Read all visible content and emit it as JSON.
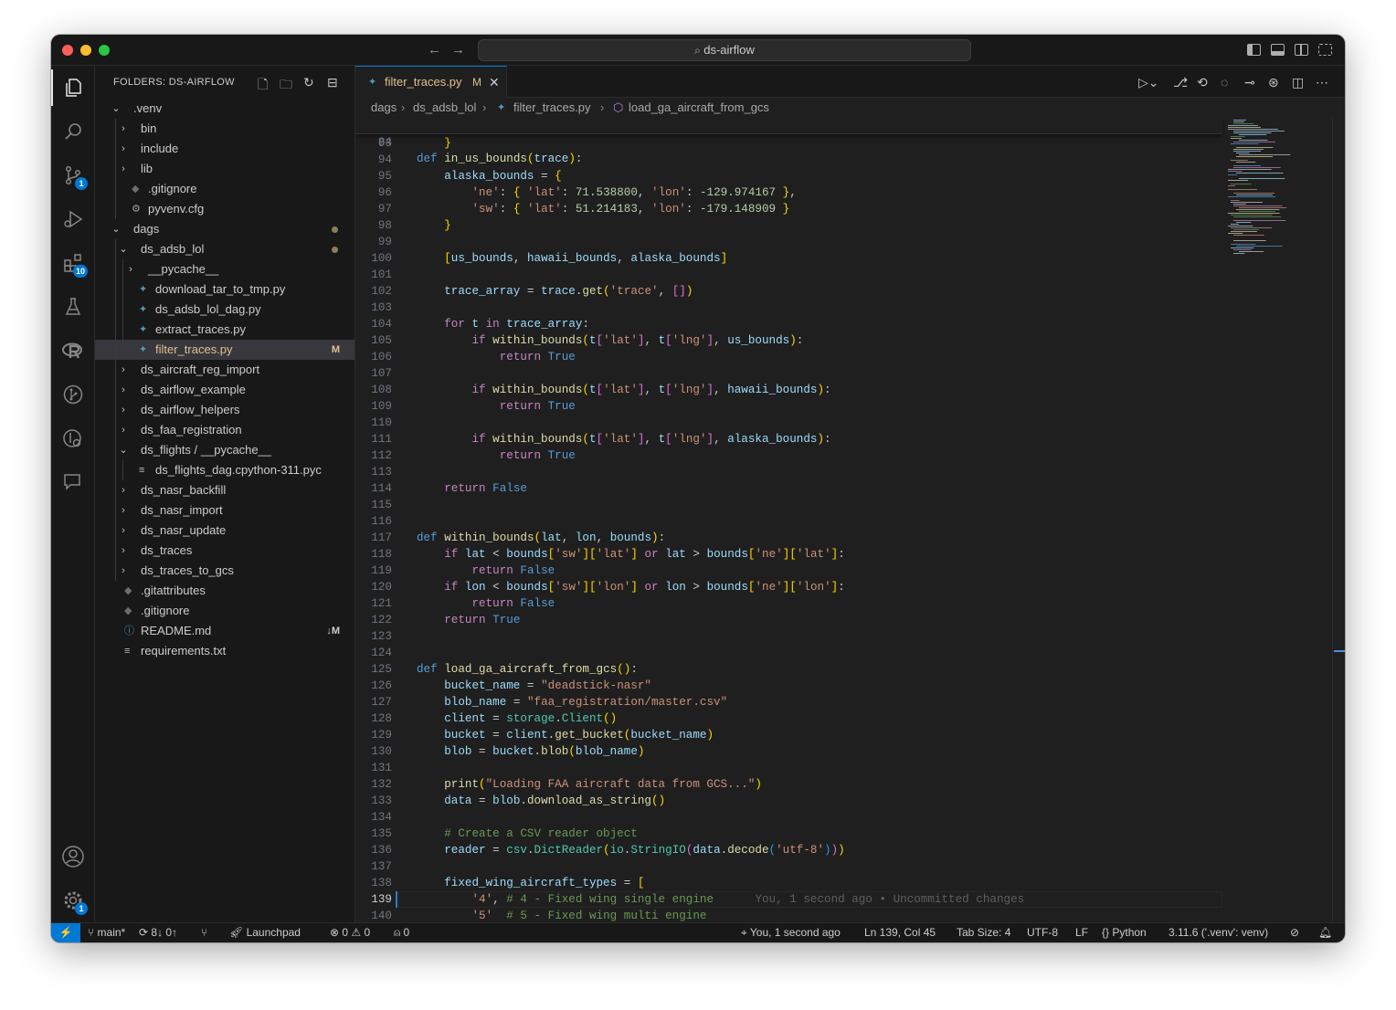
{
  "window": {
    "search_text": "ds-airflow"
  },
  "activity_bar": {
    "scm_badge": "1",
    "extensions_badge": "10",
    "manage_badge": "1"
  },
  "explorer": {
    "title": "FOLDERS: DS-AIRFLOW",
    "tree": [
      {
        "label": ".venv",
        "depth": 0,
        "kind": "folder-open",
        "deco": ""
      },
      {
        "label": "bin",
        "depth": 1,
        "kind": "folder",
        "deco": ""
      },
      {
        "label": "include",
        "depth": 1,
        "kind": "folder",
        "deco": ""
      },
      {
        "label": "lib",
        "depth": 1,
        "kind": "folder",
        "deco": ""
      },
      {
        "label": ".gitignore",
        "depth": 1,
        "kind": "git",
        "deco": ""
      },
      {
        "label": "pyvenv.cfg",
        "depth": 1,
        "kind": "gear",
        "deco": ""
      },
      {
        "label": "dags",
        "depth": 0,
        "kind": "folder-open",
        "deco": "dot"
      },
      {
        "label": "ds_adsb_lol",
        "depth": 1,
        "kind": "folder-open",
        "deco": "dot"
      },
      {
        "label": "__pycache__",
        "depth": 2,
        "kind": "folder",
        "deco": ""
      },
      {
        "label": "download_tar_to_tmp.py",
        "depth": 2,
        "kind": "py",
        "deco": ""
      },
      {
        "label": "ds_adsb_lol_dag.py",
        "depth": 2,
        "kind": "py",
        "deco": ""
      },
      {
        "label": "extract_traces.py",
        "depth": 2,
        "kind": "py",
        "deco": ""
      },
      {
        "label": "filter_traces.py",
        "depth": 2,
        "kind": "py",
        "deco": "M",
        "selected": true
      },
      {
        "label": "ds_aircraft_reg_import",
        "depth": 1,
        "kind": "folder",
        "deco": ""
      },
      {
        "label": "ds_airflow_example",
        "depth": 1,
        "kind": "folder",
        "deco": ""
      },
      {
        "label": "ds_airflow_helpers",
        "depth": 1,
        "kind": "folder",
        "deco": ""
      },
      {
        "label": "ds_faa_registration",
        "depth": 1,
        "kind": "folder",
        "deco": ""
      },
      {
        "label": "ds_flights / __pycache__",
        "depth": 1,
        "kind": "folder-open",
        "deco": ""
      },
      {
        "label": "ds_flights_dag.cpython-311.pyc",
        "depth": 2,
        "kind": "lines",
        "deco": ""
      },
      {
        "label": "ds_nasr_backfill",
        "depth": 1,
        "kind": "folder",
        "deco": ""
      },
      {
        "label": "ds_nasr_import",
        "depth": 1,
        "kind": "folder",
        "deco": ""
      },
      {
        "label": "ds_nasr_update",
        "depth": 1,
        "kind": "folder",
        "deco": ""
      },
      {
        "label": "ds_traces",
        "depth": 1,
        "kind": "folder",
        "deco": ""
      },
      {
        "label": "ds_traces_to_gcs",
        "depth": 1,
        "kind": "folder",
        "deco": ""
      },
      {
        "label": ".gitattributes",
        "depth": 0,
        "kind": "git",
        "deco": ""
      },
      {
        "label": ".gitignore",
        "depth": 0,
        "kind": "git",
        "deco": ""
      },
      {
        "label": "README.md",
        "depth": 0,
        "kind": "info",
        "deco": "↓M"
      },
      {
        "label": "requirements.txt",
        "depth": 0,
        "kind": "lines",
        "deco": ""
      }
    ]
  },
  "tab": {
    "label": "filter_traces.py",
    "status": "M"
  },
  "breadcrumb": [
    "dags",
    "ds_adsb_lol",
    "filter_traces.py",
    "load_ga_aircraft_from_gcs"
  ],
  "sticky": {
    "ln": "84",
    "code": "def in_us_bounds(trace):"
  },
  "editor": {
    "lines": [
      {
        "n": "93",
        "c": "    }"
      },
      {
        "n": "94",
        "c": ""
      },
      {
        "n": "95",
        "c": "    alaska_bounds = {"
      },
      {
        "n": "96",
        "c": "        'ne': { 'lat': 71.538800, 'lon': -129.974167 },"
      },
      {
        "n": "97",
        "c": "        'sw': { 'lat': 51.214183, 'lon': -179.148909 }"
      },
      {
        "n": "98",
        "c": "    }"
      },
      {
        "n": "99",
        "c": ""
      },
      {
        "n": "100",
        "c": "    [us_bounds, hawaii_bounds, alaska_bounds]"
      },
      {
        "n": "101",
        "c": ""
      },
      {
        "n": "102",
        "c": "    trace_array = trace.get('trace', [])"
      },
      {
        "n": "103",
        "c": ""
      },
      {
        "n": "104",
        "c": "    for t in trace_array:"
      },
      {
        "n": "105",
        "c": "        if within_bounds(t['lat'], t['lng'], us_bounds):"
      },
      {
        "n": "106",
        "c": "            return True"
      },
      {
        "n": "107",
        "c": ""
      },
      {
        "n": "108",
        "c": "        if within_bounds(t['lat'], t['lng'], hawaii_bounds):"
      },
      {
        "n": "109",
        "c": "            return True"
      },
      {
        "n": "110",
        "c": ""
      },
      {
        "n": "111",
        "c": "        if within_bounds(t['lat'], t['lng'], alaska_bounds):"
      },
      {
        "n": "112",
        "c": "            return True"
      },
      {
        "n": "113",
        "c": ""
      },
      {
        "n": "114",
        "c": "    return False"
      },
      {
        "n": "115",
        "c": ""
      },
      {
        "n": "116",
        "c": ""
      },
      {
        "n": "117",
        "c": "def within_bounds(lat, lon, bounds):"
      },
      {
        "n": "118",
        "c": "    if lat < bounds['sw']['lat'] or lat > bounds['ne']['lat']:"
      },
      {
        "n": "119",
        "c": "        return False"
      },
      {
        "n": "120",
        "c": "    if lon < bounds['sw']['lon'] or lon > bounds['ne']['lon']:"
      },
      {
        "n": "121",
        "c": "        return False"
      },
      {
        "n": "122",
        "c": "    return True"
      },
      {
        "n": "123",
        "c": ""
      },
      {
        "n": "124",
        "c": ""
      },
      {
        "n": "125",
        "c": "def load_ga_aircraft_from_gcs():"
      },
      {
        "n": "126",
        "c": "    bucket_name = \"deadstick-nasr\""
      },
      {
        "n": "127",
        "c": "    blob_name = \"faa_registration/master.csv\""
      },
      {
        "n": "128",
        "c": "    client = storage.Client()"
      },
      {
        "n": "129",
        "c": "    bucket = client.get_bucket(bucket_name)"
      },
      {
        "n": "130",
        "c": "    blob = bucket.blob(blob_name)"
      },
      {
        "n": "131",
        "c": ""
      },
      {
        "n": "132",
        "c": "    print(\"Loading FAA aircraft data from GCS...\")"
      },
      {
        "n": "133",
        "c": "    data = blob.download_as_string()"
      },
      {
        "n": "134",
        "c": ""
      },
      {
        "n": "135",
        "c": "    # Create a CSV reader object"
      },
      {
        "n": "136",
        "c": "    reader = csv.DictReader(io.StringIO(data.decode('utf-8')))"
      },
      {
        "n": "137",
        "c": ""
      },
      {
        "n": "138",
        "c": "    fixed_wing_aircraft_types = ["
      },
      {
        "n": "139",
        "c": "        '4', # 4 - Fixed wing single engine",
        "blame": "You, 1 second ago • Uncommitted changes",
        "current": true
      },
      {
        "n": "140",
        "c": "        '5'  # 5 - Fixed wing multi engine"
      }
    ]
  },
  "status": {
    "branch": "main*",
    "sync": "8↓ 0↑",
    "launchpad": "Launchpad",
    "errors": "0",
    "warnings": "0",
    "ports": "0",
    "blame": "You, 1 second ago",
    "position": "Ln 139, Col 45",
    "tab_size": "Tab Size: 4",
    "encoding": "UTF-8",
    "eol": "LF",
    "language": "Python",
    "interpreter": "3.11.6 ('.venv': venv)"
  }
}
